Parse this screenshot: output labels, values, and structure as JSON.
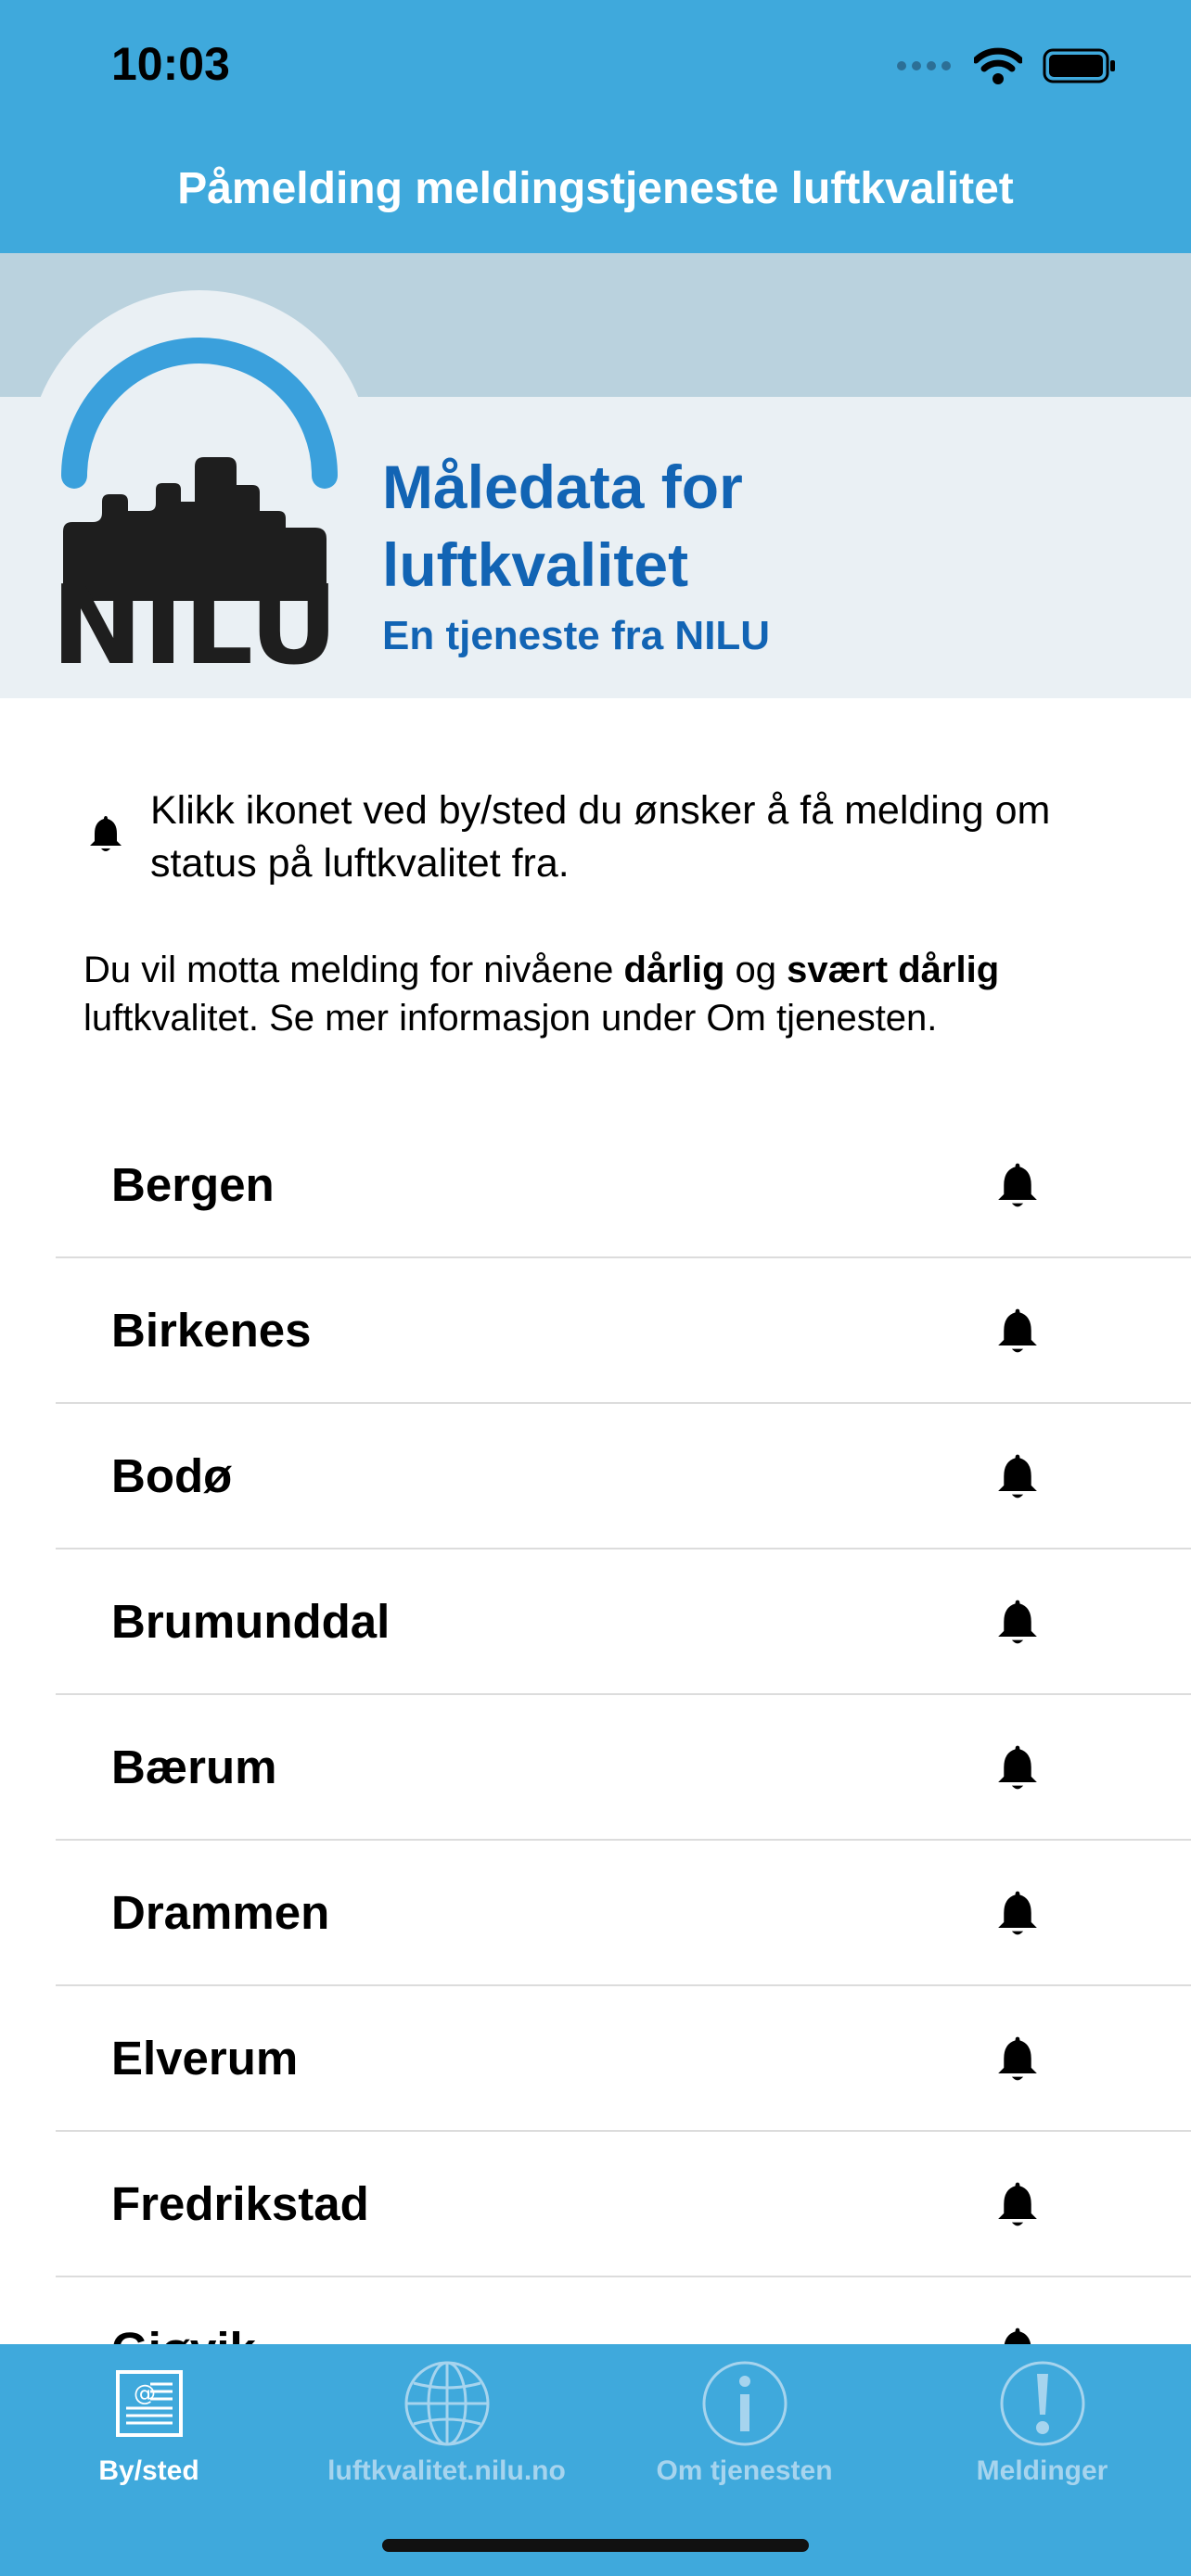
{
  "status_bar": {
    "time": "10:03"
  },
  "header": {
    "title": "Påmelding meldingstjeneste luftkvalitet"
  },
  "banner": {
    "logo_text": "NILU",
    "line1": "Måledata for",
    "line2": "luftkvalitet",
    "subtitle": "En tjeneste fra NILU"
  },
  "intro": {
    "text": "Klikk ikonet ved by/sted du ønsker å få melding om status på luftkvalitet fra.",
    "info_prefix": "Du vil motta melding for nivåene",
    "info_bold1": "dårlig",
    "info_and": "og",
    "info_bold2": "svært dårlig",
    "info_suffix": "luftkvalitet. Se mer informasjon under Om tjenesten."
  },
  "cities": [
    {
      "name": "Bergen"
    },
    {
      "name": "Birkenes"
    },
    {
      "name": "Bodø"
    },
    {
      "name": "Brumunddal"
    },
    {
      "name": "Bærum"
    },
    {
      "name": "Drammen"
    },
    {
      "name": "Elverum"
    },
    {
      "name": "Fredrikstad"
    },
    {
      "name": "Gjøvik"
    }
  ],
  "tabs": [
    {
      "label": "By/sted",
      "icon": "news-icon",
      "active": true
    },
    {
      "label": "luftkvalitet.nilu.no",
      "icon": "globe-icon",
      "active": false
    },
    {
      "label": "Om tjenesten",
      "icon": "info-icon",
      "active": false
    },
    {
      "label": "Meldinger",
      "icon": "alert-icon",
      "active": false
    }
  ],
  "colors": {
    "primary_blue": "#3fa9dc",
    "banner_text_blue": "#1264b4",
    "banner_light": "#eaf0f4",
    "banner_band": "#bad2de",
    "tab_inactive": "#a6d4ee"
  }
}
